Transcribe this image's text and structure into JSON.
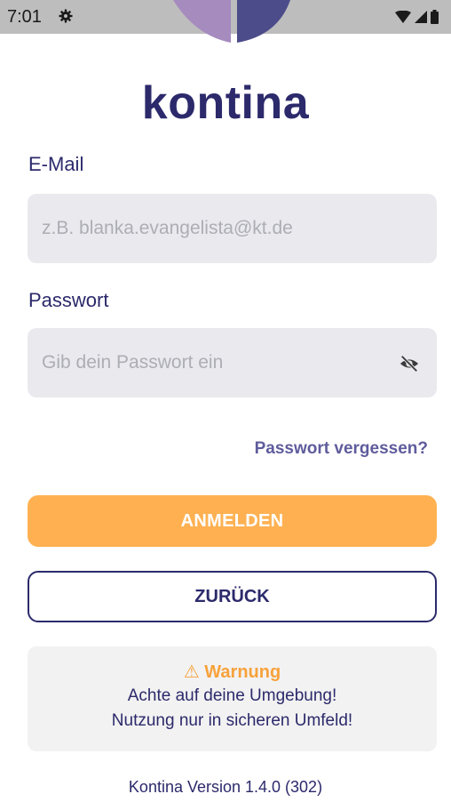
{
  "status_bar": {
    "time": "7:01",
    "icons": [
      "gear-icon",
      "wifi-icon",
      "signal-icon",
      "battery-icon"
    ]
  },
  "brand": {
    "name": "kontina"
  },
  "email": {
    "label": "E-Mail",
    "value": "",
    "placeholder": "z.B. blanka.evangelista@kt.de"
  },
  "password": {
    "label": "Passwort",
    "value": "",
    "placeholder": "Gib dein Passwort ein",
    "visibility_icon": "eye-off-icon"
  },
  "forgot_link": "Passwort vergessen?",
  "buttons": {
    "login": "ANMELDEN",
    "back": "ZURÜCK"
  },
  "warning": {
    "icon": "⚠",
    "title": "Warnung",
    "line1": "Achte auf deine Umgebung!",
    "line2": "Nutzung nur in sicheren Umfeld!"
  },
  "version": "Kontina Version 1.4.0 (302)",
  "colors": {
    "brand": "#2c2a6b",
    "accent": "#ffb152",
    "warning": "#f7a23b",
    "link": "#5f5c9c",
    "field_bg": "#e9e9ee"
  }
}
